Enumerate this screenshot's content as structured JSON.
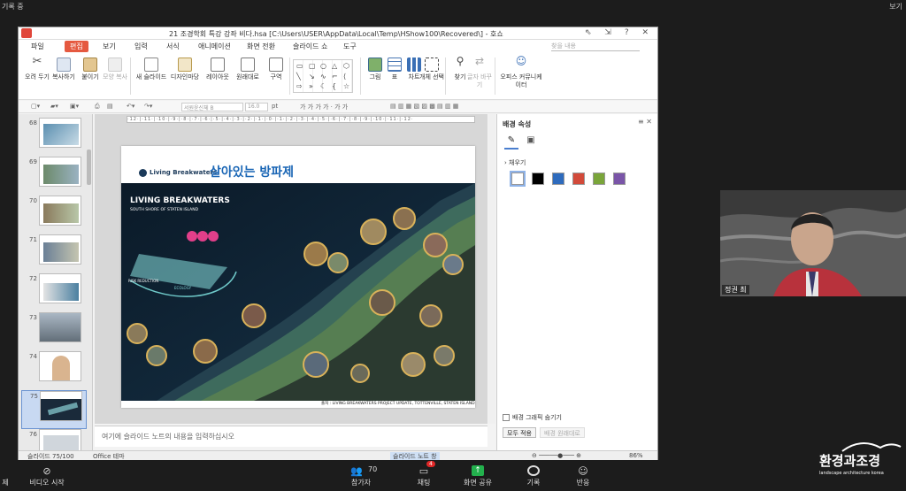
{
  "zoom": {
    "recording_label": "기록 중",
    "view_label": "보기",
    "participants_count": "70",
    "chat_badge": "4",
    "bottom_items": [
      "비디오 시작",
      "참가자",
      "채팅",
      "화면 공유",
      "기록",
      "반응"
    ],
    "left_edge_label": "제",
    "video_name": "정권 최"
  },
  "app": {
    "title": "21 조경학회 특강 강좌 비다.hsa [C:\\Users\\USER\\AppData\\Local\\Temp\\HShow100\\Recovered\\] - 호쇼",
    "window_buttons": "⇖ ⇲ ? ✕",
    "menu": {
      "items": [
        "파일",
        "편집",
        "보기",
        "입력",
        "서식",
        "애니메이션",
        "화면 전환",
        "슬라이드 쇼",
        "도구"
      ],
      "search_placeholder": "찾을 내용"
    },
    "ribbon": {
      "cut": "오려 두기",
      "copy": "복사하기",
      "paste": "붙이기",
      "format_copy": "모양 복사",
      "new_slide": "새 슬라이드",
      "design": "디자인마당",
      "layout": "레이아웃",
      "reset": "원래대로",
      "section": "구역",
      "picture": "그림",
      "table": "표",
      "chart": "차트",
      "select_object": "개체 선택",
      "find": "찾기",
      "replace": "글자 바꾸기",
      "office_communicator": "오피스 커뮤니케이터"
    },
    "format_bar": {
      "font": "서원윤신체 B",
      "size": "16.0",
      "unit": "pt"
    },
    "thumbnails": [
      "68",
      "69",
      "70",
      "71",
      "72",
      "73",
      "74",
      "75",
      "76"
    ],
    "selected_slide": "75",
    "slide": {
      "header_en": "Living Breakwaters",
      "header_ko": "살아있는 방파제",
      "map_title": "LIVING BREAKWATERS",
      "map_subtitle": "SOUTH SHORE OF STATEN ISLAND",
      "map_labels": [
        "RISK REDUCTION",
        "ECOLOGY"
      ],
      "caption": "출처 : LIVING BREAKWATERS PROJECT UPDATE, TOTTENVILLE, STATEN ISLAND"
    },
    "notes_placeholder": "여기에 슬라이드 노트의 내용을 입력하십시오",
    "panel": {
      "title": "배경 속성",
      "fill_label": "채우기",
      "colors": [
        "#ffffff",
        "#000000",
        "#2e6bbd",
        "#d24a3a",
        "#7aa53a",
        "#7a55a8"
      ],
      "hide_graphics": "배경 그래픽 숨기기",
      "apply_all": "모두 적용",
      "reset_bg": "배경 원래대로"
    },
    "status": {
      "slide_pos": "슬라이드 75/100",
      "theme": "Office 테마",
      "notes_button": "슬라이드 노트 창",
      "zoom": "86%"
    }
  },
  "brand": {
    "ko": "환경과조경",
    "en": "landscape architecture korea"
  }
}
